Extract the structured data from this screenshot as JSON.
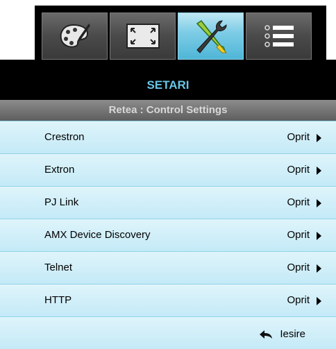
{
  "tabs": [
    {
      "name": "image-settings",
      "icon": "palette-icon",
      "active": false
    },
    {
      "name": "display",
      "icon": "expand-screen-icon",
      "active": false
    },
    {
      "name": "setup",
      "icon": "tools-icon",
      "active": true
    },
    {
      "name": "options",
      "icon": "list-icon",
      "active": false
    }
  ],
  "header": {
    "title": "SETARI",
    "subtitle": "Retea : Control Settings"
  },
  "rows": [
    {
      "label": "Crestron",
      "value": "Oprit"
    },
    {
      "label": "Extron",
      "value": "Oprit"
    },
    {
      "label": "PJ Link",
      "value": "Oprit"
    },
    {
      "label": "AMX Device Discovery",
      "value": "Oprit"
    },
    {
      "label": "Telnet",
      "value": "Oprit"
    },
    {
      "label": "HTTP",
      "value": "Oprit"
    }
  ],
  "exit": {
    "label": "Iesire",
    "icon": "back-arrow-icon"
  },
  "colors": {
    "accent": "#67c6e8",
    "row_bg": "#d4f0fa",
    "header_bg": "#000000"
  }
}
